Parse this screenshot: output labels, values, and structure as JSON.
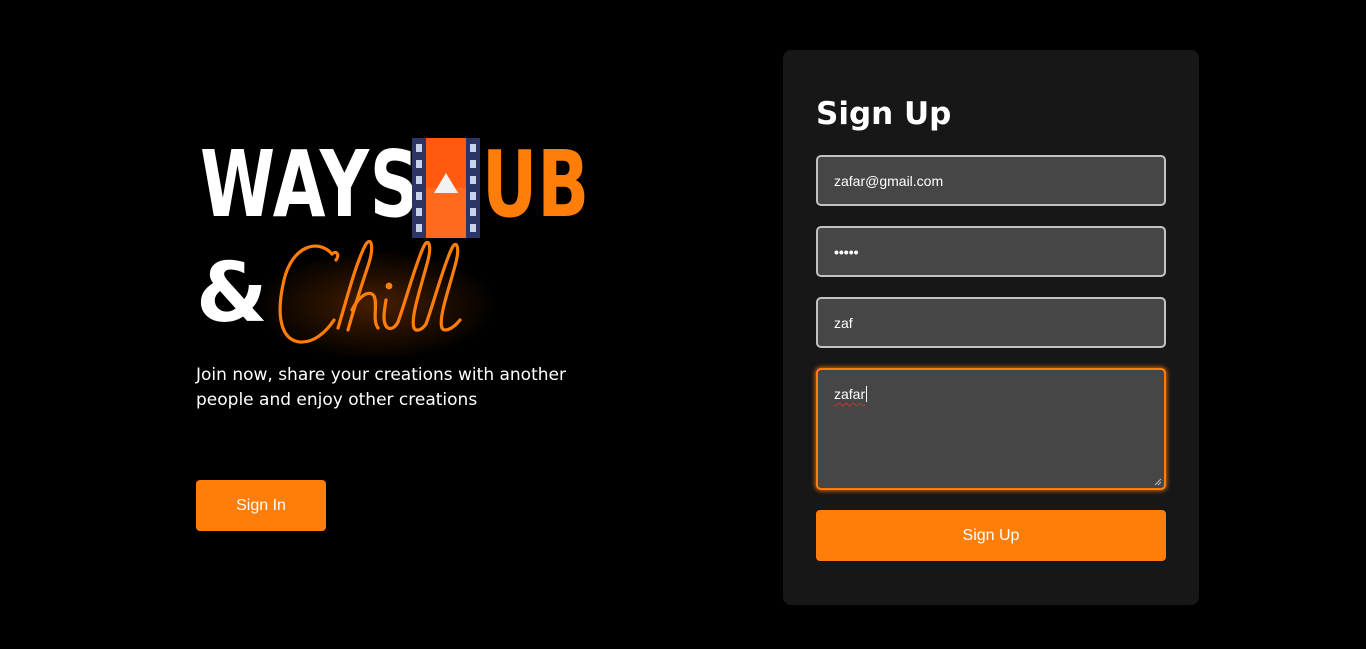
{
  "brand": {
    "logo_word_1": "WAYS",
    "logo_word_2": "UB",
    "amp": "&",
    "script_word": "Chill",
    "accent_color": "#ff7e0a"
  },
  "hero": {
    "tagline": "Join now, share your creations with another people and enjoy other creations",
    "signin_label": "Sign In"
  },
  "form": {
    "title": "Sign Up",
    "email_value": "zafar@gmail.com",
    "password_mask": "•••••",
    "name_value": "zaf",
    "bio_value": "zafar",
    "submit_label": "Sign Up"
  },
  "colors": {
    "background": "#000000",
    "card": "#171717",
    "input_bg": "#464646",
    "input_border": "#c2c2c2",
    "accent": "#ff7e0a"
  },
  "icons": {
    "film_logo": "film-play-icon",
    "resize_grip": "resize-grip-icon"
  }
}
